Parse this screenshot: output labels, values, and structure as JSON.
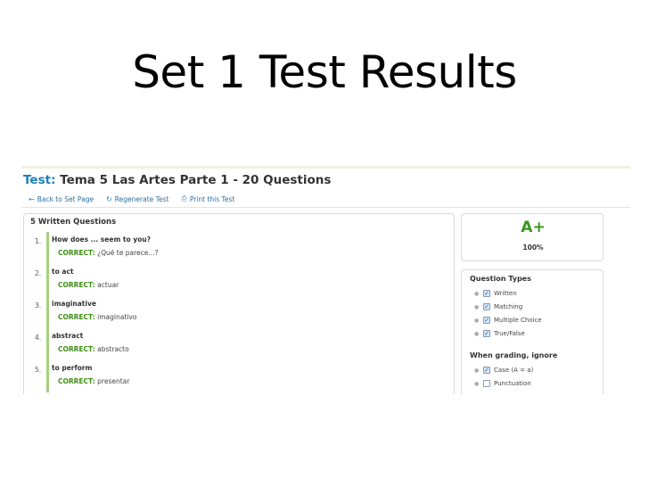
{
  "slide": {
    "title": "Set 1 Test Results"
  },
  "test": {
    "label": "Test:",
    "name": "Tema 5 Las Artes Parte 1 - 20 Questions"
  },
  "toolbar": {
    "back": {
      "icon": "arrow-left-icon",
      "label": "Back to Set Page"
    },
    "regenerate": {
      "icon": "refresh-icon",
      "label": "Regenerate Test"
    },
    "print": {
      "icon": "print-icon",
      "label": "Print this Test"
    }
  },
  "questions": {
    "title": "5 Written Questions",
    "correct_label": "CORRECT:",
    "items": [
      {
        "num": "1.",
        "prompt": "How does ... seem to you?",
        "answer": "¿Qué te parece...?"
      },
      {
        "num": "2.",
        "prompt": "to act",
        "answer": "actuar"
      },
      {
        "num": "3.",
        "prompt": "imaginative",
        "answer": "imaginativo"
      },
      {
        "num": "4.",
        "prompt": "abstract",
        "answer": "abstracto"
      },
      {
        "num": "5.",
        "prompt": "to perform",
        "answer": "presentar"
      }
    ]
  },
  "grade": {
    "letter": "A+",
    "percent": "100%"
  },
  "question_types": {
    "title": "Question Types",
    "items": [
      {
        "label": "Written",
        "checked": true
      },
      {
        "label": "Matching",
        "checked": true
      },
      {
        "label": "Multiple Choice",
        "checked": true
      },
      {
        "label": "True/False",
        "checked": true
      }
    ]
  },
  "grading": {
    "title": "When grading, ignore",
    "items": [
      {
        "label": "Case (A = a)",
        "checked": true
      },
      {
        "label": "Punctuation",
        "checked": false
      }
    ]
  },
  "colors": {
    "link_blue": "#1b7fb8",
    "correct_green": "#3e8e16",
    "grade_green": "#36961a",
    "bar_green": "#a4d07f"
  }
}
